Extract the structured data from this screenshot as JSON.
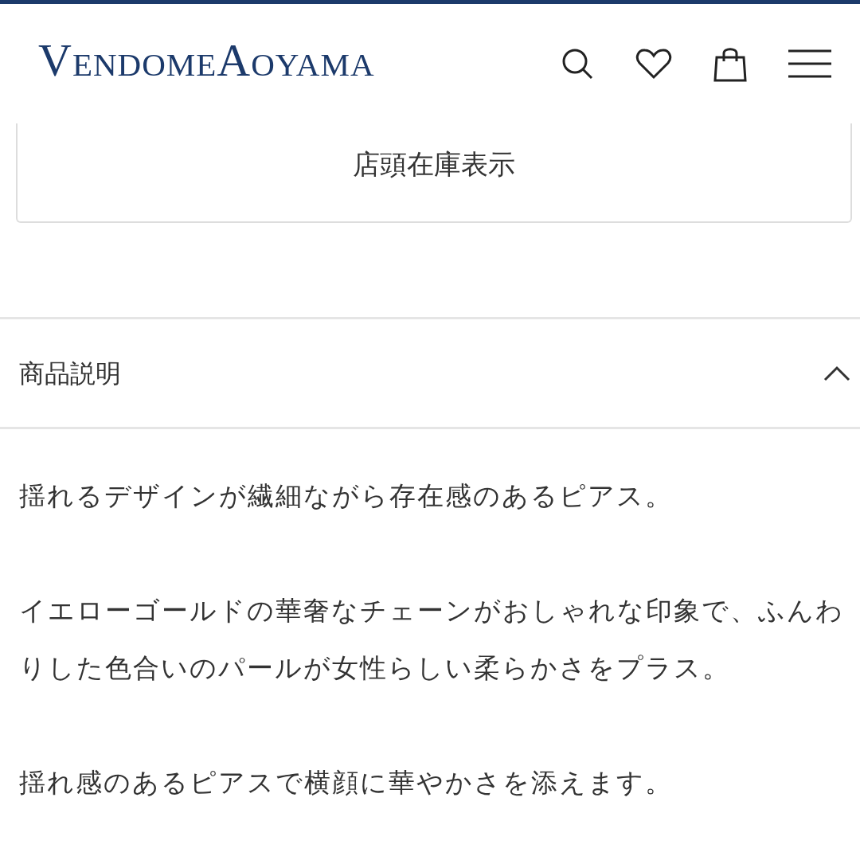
{
  "header": {
    "logo": "VendomeAoyama"
  },
  "stock_button": {
    "label": "店頭在庫表示"
  },
  "section": {
    "title": "商品説明",
    "expanded": true,
    "paragraphs": [
      "揺れるデザインが繊細ながら存在感のあるピアス。",
      "イエローゴールドの華奢なチェーンがおしゃれな印象で、ふんわりした色合いのパールが女性らしい柔らかさをプラス。",
      "揺れ感のあるピアスで横顔に華やかさを添えます。"
    ]
  }
}
